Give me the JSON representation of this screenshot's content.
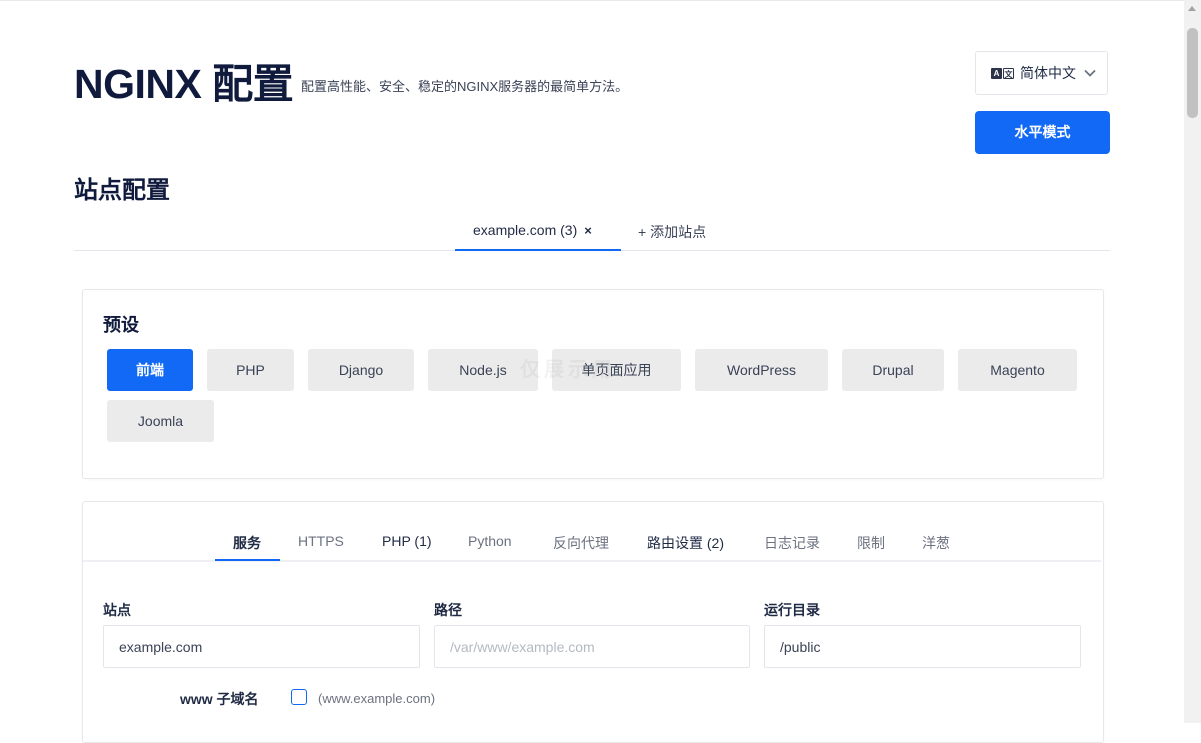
{
  "header": {
    "title": "NGINX 配置",
    "subtitle": "配置高性能、安全、稳定的NGINX服务器的最简单方法。",
    "language": "简体中文",
    "mode_button": "水平模式"
  },
  "site_section": {
    "title": "站点配置",
    "tabs": [
      {
        "label": "example.com (3)",
        "close": "×"
      },
      {
        "label": "+ 添加站点"
      }
    ]
  },
  "presets": {
    "title": "预设",
    "items": [
      "前端",
      "PHP",
      "Django",
      "Node.js",
      "单页面应用",
      "WordPress",
      "Drupal",
      "Magento",
      "Joomla"
    ],
    "active": "前端"
  },
  "watermark": "仅展示用",
  "config_tabs": {
    "items": [
      "服务",
      "HTTPS",
      "PHP (1)",
      "Python",
      "反向代理",
      "路由设置 (2)",
      "日志记录",
      "限制",
      "洋葱"
    ],
    "active": "服务"
  },
  "fields": {
    "site": {
      "label": "站点",
      "value": "example.com"
    },
    "path": {
      "label": "路径",
      "placeholder": "/var/www/example.com"
    },
    "document_root": {
      "label": "运行目录",
      "value": "/public"
    }
  },
  "subdomain": {
    "label": "www 子域名",
    "checked": false,
    "note": "(www.example.com)"
  },
  "colors": {
    "accent": "#1169f5",
    "title": "#0f1a3c",
    "preset_bg": "#ebebeb"
  }
}
